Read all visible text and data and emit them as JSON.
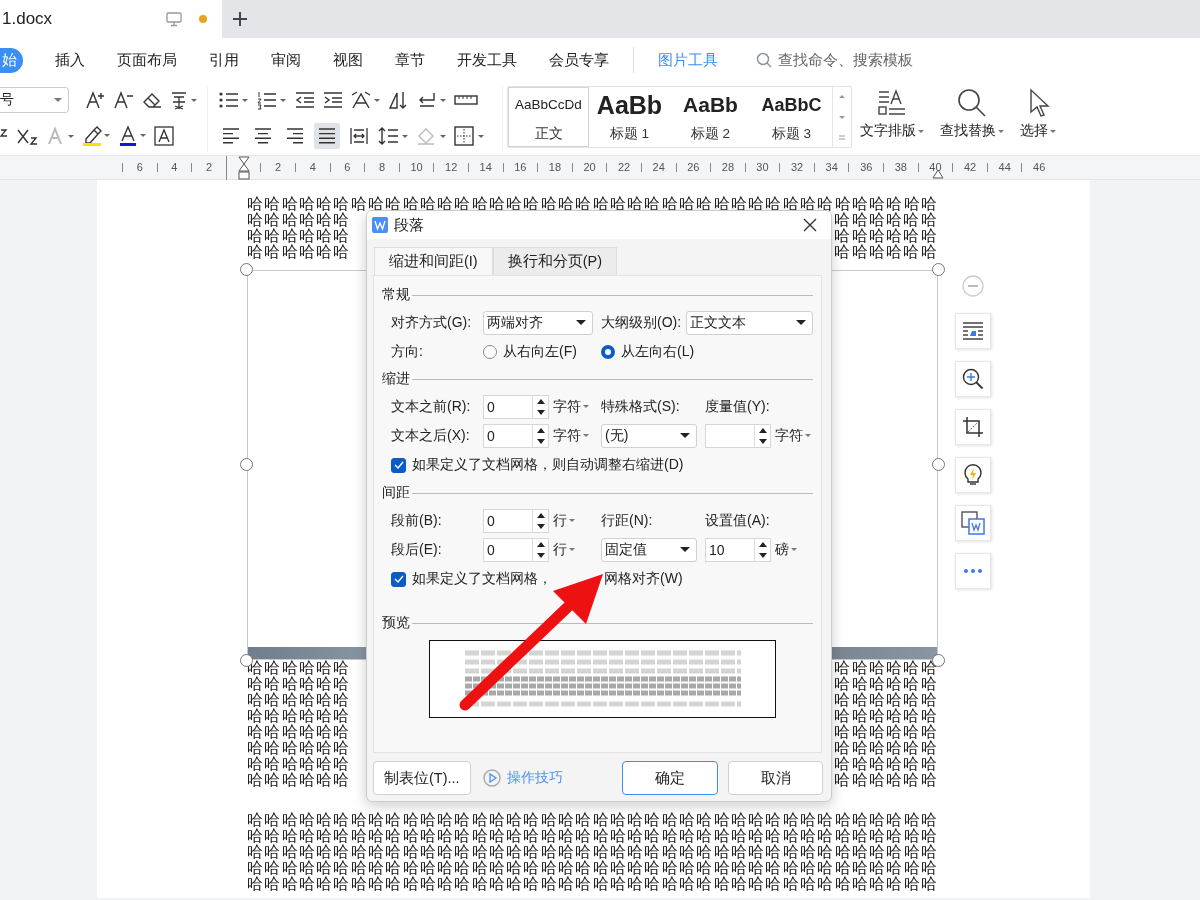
{
  "tab_bar": {
    "document_tab": {
      "title": "1.docx",
      "modified": true
    }
  },
  "menu_tabs": [
    {
      "label": "始",
      "selected": true
    },
    {
      "label": "插入",
      "selected": false
    },
    {
      "label": "页面布局",
      "selected": false
    },
    {
      "label": "引用",
      "selected": false
    },
    {
      "label": "审阅",
      "selected": false
    },
    {
      "label": "视图",
      "selected": false
    },
    {
      "label": "章节",
      "selected": false
    },
    {
      "label": "开发工具",
      "selected": false
    },
    {
      "label": "会员专享",
      "selected": false
    }
  ],
  "context_tab": "图片工具",
  "command_search": {
    "placeholder": "查找命令、搜索模板"
  },
  "ribbon": {
    "font_size": "号",
    "paragraph_align": [
      {
        "kind": "left",
        "selected": false
      },
      {
        "kind": "center",
        "selected": false
      },
      {
        "kind": "right",
        "selected": false
      },
      {
        "kind": "justify",
        "selected": true
      },
      {
        "kind": "distributed",
        "selected": false
      }
    ],
    "styles": [
      {
        "kind": "normal",
        "sample": "AaBbCcDd",
        "name": "正文",
        "selected": true
      },
      {
        "kind": "heading1",
        "sample": "AaBb",
        "name": "标题 1",
        "selected": false
      },
      {
        "kind": "heading2",
        "sample": "AaBb",
        "name": "标题 2",
        "selected": false
      },
      {
        "kind": "heading3",
        "sample": "AaBbC",
        "name": "标题 3",
        "selected": false
      }
    ],
    "text_layout": "文字排版",
    "find_replace": "查找替换",
    "select": "选择"
  },
  "ruler": {
    "left_labels": [
      "6",
      "4",
      "2"
    ],
    "right_labels": [
      "2",
      "4",
      "6",
      "8",
      "10",
      "12",
      "14",
      "16",
      "18",
      "20",
      "22",
      "24",
      "26",
      "28",
      "30",
      "32",
      "34",
      "36",
      "38",
      "40",
      "42",
      "44",
      "46"
    ]
  },
  "document": {
    "top_lines": [
      "哈哈哈哈哈哈哈哈哈哈哈哈哈哈哈哈哈哈哈哈哈哈哈哈哈哈哈哈哈哈哈哈哈哈哈哈哈哈哈哈"
    ],
    "split_lines_top": [
      {
        "left": "哈哈哈哈哈哈",
        "right": "哈哈哈哈哈哈"
      },
      {
        "left": "哈哈哈哈哈哈",
        "right": "哈哈哈哈哈哈"
      },
      {
        "left": "哈哈哈哈哈哈",
        "right": "哈哈哈哈哈哈"
      }
    ],
    "split_lines_bottom": [
      {
        "left": "哈哈哈哈哈哈",
        "right": "哈哈哈哈哈哈"
      },
      {
        "left": "哈哈哈哈哈哈",
        "right": "哈哈哈哈哈哈"
      },
      {
        "left": "哈哈哈哈哈哈",
        "right": "哈哈哈哈哈哈"
      },
      {
        "left": "哈哈哈哈哈哈",
        "right": "哈哈哈哈哈哈"
      },
      {
        "left": "哈哈哈哈哈哈",
        "right": "哈哈哈哈哈哈"
      },
      {
        "left": "哈哈哈哈哈哈",
        "right": "哈哈哈哈哈哈"
      },
      {
        "left": "哈哈哈哈哈哈",
        "right": "哈哈哈哈哈哈"
      },
      {
        "left": "哈哈哈哈哈哈",
        "right": "哈哈哈哈哈哈"
      }
    ],
    "bottom_lines": [
      "哈哈哈哈哈哈哈哈哈哈哈哈哈哈哈哈哈哈哈哈哈哈哈哈哈哈哈哈哈哈哈哈哈哈哈哈哈哈哈哈",
      "哈哈哈哈哈哈哈哈哈哈哈哈哈哈哈哈哈哈哈哈哈哈哈哈哈哈哈哈哈哈哈哈哈哈哈哈哈哈哈哈",
      "哈哈哈哈哈哈哈哈哈哈哈哈哈哈哈哈哈哈哈哈哈哈哈哈哈哈哈哈哈哈哈哈哈哈哈哈哈哈哈哈",
      "哈哈哈哈哈哈哈哈哈哈哈哈哈哈哈哈哈哈哈哈哈哈哈哈哈哈哈哈哈哈哈哈哈哈哈哈哈哈哈哈",
      "哈哈哈哈哈哈哈哈哈哈哈哈哈哈哈哈哈哈哈哈哈哈哈哈哈哈哈哈哈哈哈哈哈哈哈哈哈哈哈哈"
    ]
  },
  "dialog": {
    "title": "段落",
    "tabs": [
      {
        "label": "缩进和间距(I)",
        "selected": true
      },
      {
        "label": "换行和分页(P)",
        "selected": false
      }
    ],
    "general": {
      "heading": "常规",
      "alignment": {
        "label": "对齐方式(G):",
        "value": "两端对齐"
      },
      "outline": {
        "label": "大纲级别(O):",
        "value": "正文文本"
      },
      "direction": {
        "label": "方向:",
        "options": [
          {
            "label": "从右向左(F)",
            "selected": false
          },
          {
            "label": "从左向右(L)",
            "selected": true
          }
        ]
      }
    },
    "indent": {
      "heading": "缩进",
      "before": {
        "label": "文本之前(R):",
        "value": "0",
        "unit": "字符"
      },
      "after": {
        "label": "文本之后(X):",
        "value": "0",
        "unit": "字符"
      },
      "special": {
        "label": "特殊格式(S):",
        "value": "(无)"
      },
      "measure": {
        "label": "度量值(Y):",
        "unit": "字符"
      },
      "auto_adjust": {
        "label": "如果定义了文档网格，则自动调整右缩进(D)",
        "checked": true
      }
    },
    "spacing": {
      "heading": "间距",
      "before": {
        "label": "段前(B):",
        "value": "0",
        "unit": "行"
      },
      "after": {
        "label": "段后(E):",
        "value": "0",
        "unit": "行"
      },
      "line_spacing": {
        "label": "行距(N):",
        "value": "固定值"
      },
      "set_value": {
        "label": "设置值(A):",
        "value": "10",
        "unit": "磅"
      },
      "snap_to_grid": {
        "label_start": "如果定义了文档网格，",
        "label_end": "网格对齐(W)",
        "checked": true
      }
    },
    "preview": {
      "heading": "预览"
    },
    "tab_stops_button": "制表位(T)...",
    "tips_link": "操作技巧",
    "ok_button": "确定",
    "cancel_button": "取消"
  }
}
